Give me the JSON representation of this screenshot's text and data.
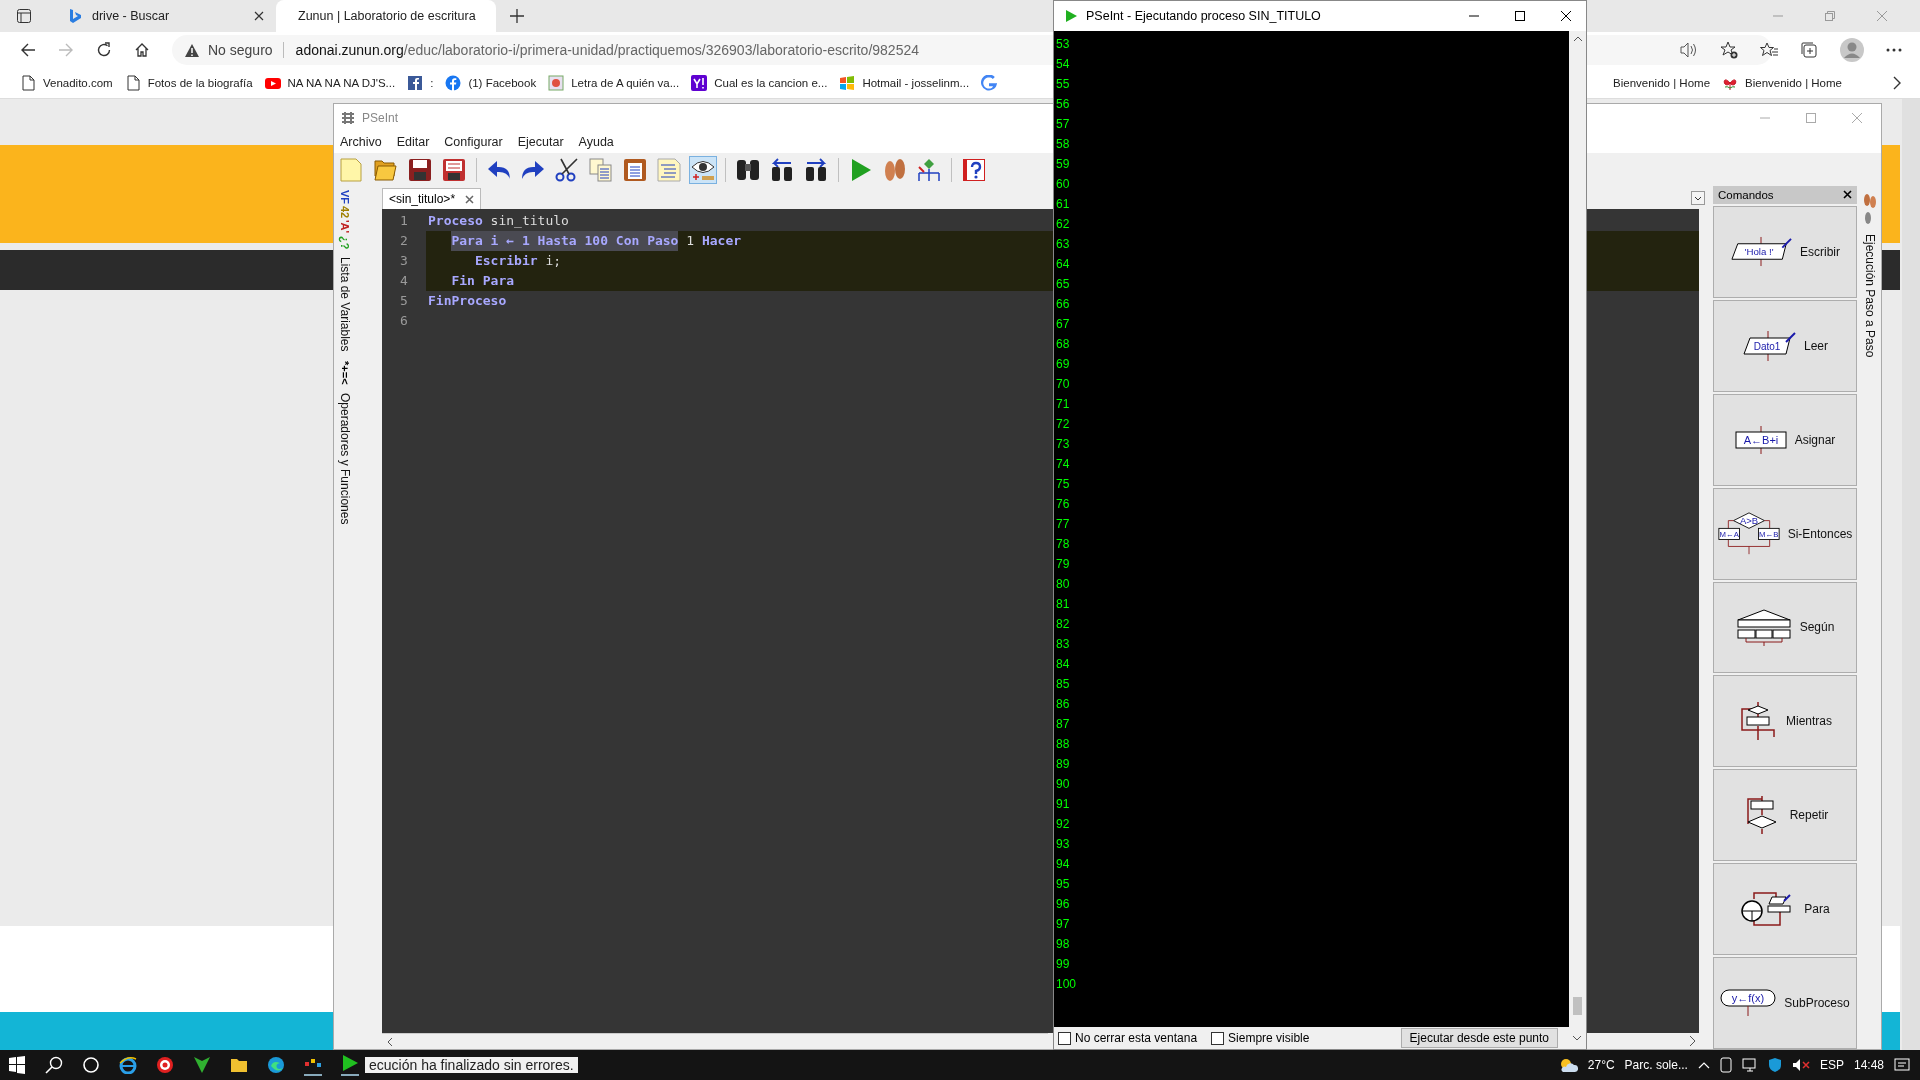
{
  "browser": {
    "tabs": [
      {
        "title": "drive - Buscar",
        "selected": false
      },
      {
        "title": "Zunun | Laboratorio de escritura",
        "selected": true
      }
    ],
    "address": {
      "security": "No seguro",
      "host": "adonai.zunun.org",
      "path": "/educ/laboratorio-i/primera-unidad/practiquemos/326903/laboratorio-escrito/982524"
    },
    "bookmarks": [
      {
        "label": "Venadito.com",
        "kind": "page"
      },
      {
        "label": "Fotos de la biografía",
        "kind": "page"
      },
      {
        "label": "NA NA NA NA DJ'S...",
        "kind": "video"
      },
      {
        "label": ":",
        "kind": "fb-square"
      },
      {
        "label": "(1) Facebook",
        "kind": "fb-round"
      },
      {
        "label": "Letra de A quién va...",
        "kind": "music"
      },
      {
        "label": "Cual es la cancion e...",
        "kind": "yahoo"
      },
      {
        "label": "Hotmail - josselinm...",
        "kind": "windows"
      }
    ],
    "bookmarks_right": [
      {
        "label": "Bienvenido | Home",
        "kind": "plain"
      },
      {
        "label": "Bienvenido | Home",
        "kind": "flower"
      }
    ]
  },
  "pseint": {
    "title": "PSeInt",
    "menu": [
      "Archivo",
      "Editar",
      "Configurar",
      "Ejecutar",
      "Ayuda"
    ],
    "toolbar": [
      [
        {
          "kind": "new",
          "pressed": false
        },
        {
          "kind": "open",
          "pressed": false
        },
        {
          "kind": "save",
          "pressed": false
        },
        {
          "kind": "saveas",
          "pressed": false
        }
      ],
      [
        {
          "kind": "undo",
          "pressed": false
        },
        {
          "kind": "redo",
          "pressed": false
        },
        {
          "kind": "cut",
          "pressed": false
        },
        {
          "kind": "copy",
          "pressed": false
        },
        {
          "kind": "paste",
          "pressed": false
        },
        {
          "kind": "indent",
          "pressed": false
        },
        {
          "kind": "eye",
          "pressed": true
        }
      ],
      [
        {
          "kind": "find",
          "pressed": false
        },
        {
          "kind": "findprev",
          "pressed": false
        },
        {
          "kind": "findnext",
          "pressed": false
        }
      ],
      [
        {
          "kind": "run",
          "pressed": false
        },
        {
          "kind": "step",
          "pressed": false
        },
        {
          "kind": "flow",
          "pressed": false
        }
      ],
      [
        {
          "kind": "help",
          "pressed": false
        }
      ]
    ],
    "side_tabs": [
      {
        "glyphs": [
          {
            "text": "VF",
            "color": "#2040c0"
          },
          {
            "text": "42",
            "color": "#a08000"
          },
          {
            "text": "'A'",
            "color": "#c02020"
          },
          {
            "text": "¿?",
            "color": "#20a020"
          }
        ],
        "label": "Lista de Variables"
      },
      {
        "glyphs": [
          {
            "text": "*+=<",
            "color": "#000000"
          }
        ],
        "label": "Operadores y Funciones"
      }
    ],
    "file_tab": {
      "label": "<sin_titulo>*",
      "selected": true
    },
    "code": [
      {
        "number": "1",
        "highlighted": false,
        "tokens": [
          {
            "text": "Proceso",
            "kind": "keyword"
          },
          {
            "text": "sin_titulo",
            "kind": "ident"
          }
        ],
        "children": [
          {
            "number": "2",
            "highlighted": true,
            "selection": "Para i ← 1 Hasta 100 Con Paso",
            "tokens": [
              {
                "text": "1",
                "kind": "number"
              },
              {
                "text": "Hacer",
                "kind": "keyword"
              }
            ],
            "children": [
              {
                "number": "3",
                "highlighted": true,
                "tokens": [
                  {
                    "text": "Escribir",
                    "kind": "keyword"
                  },
                  {
                    "text": "i;",
                    "kind": "ident"
                  }
                ]
              }
            ]
          },
          {
            "number": "4",
            "highlighted": true,
            "tokens": [
              {
                "text": "Fin Para",
                "kind": "keyword"
              }
            ]
          }
        ]
      },
      {
        "number": "5",
        "highlighted": false,
        "tokens": [
          {
            "text": "FinProceso",
            "kind": "keyword"
          }
        ]
      },
      {
        "number": "6",
        "highlighted": false
      }
    ],
    "commands_title": "Comandos",
    "commands": [
      {
        "label": "Escribir",
        "kind": "escribir",
        "texts": [
          "'Hola !'"
        ]
      },
      {
        "label": "Leer",
        "kind": "leer",
        "texts": [
          "Dato1"
        ]
      },
      {
        "label": "Asignar",
        "kind": "asignar",
        "texts": [
          "A←B+i"
        ]
      },
      {
        "label": "Si-Entonces",
        "kind": "si",
        "texts": [
          "A>B",
          "M←A",
          "M←B"
        ]
      },
      {
        "label": "Según",
        "kind": "segun"
      },
      {
        "label": "Mientras",
        "kind": "mientras"
      },
      {
        "label": "Repetir",
        "kind": "repetir"
      },
      {
        "label": "Para",
        "kind": "para"
      },
      {
        "label": "SubProceso",
        "kind": "subproceso",
        "texts": [
          "y←f(x)"
        ]
      }
    ],
    "right_tab": "Ejecución Paso a Paso",
    "status": "ecución ha finalizado sin errores."
  },
  "console": {
    "title": "PSeInt - Ejecutando proceso SIN_TITULO",
    "lines": [
      "53",
      "54",
      "55",
      "56",
      "57",
      "58",
      "59",
      "60",
      "61",
      "62",
      "63",
      "64",
      "65",
      "66",
      "67",
      "68",
      "69",
      "70",
      "71",
      "72",
      "73",
      "74",
      "75",
      "76",
      "77",
      "78",
      "79",
      "80",
      "81",
      "82",
      "83",
      "84",
      "85",
      "86",
      "87",
      "88",
      "89",
      "90",
      "91",
      "92",
      "93",
      "94",
      "95",
      "96",
      "97",
      "98",
      "99",
      "100"
    ],
    "options": [
      {
        "label": "No cerrar esta ventana",
        "checked": false
      },
      {
        "label": "Siempre visible",
        "checked": false
      }
    ],
    "button": "Ejecutar desde este punto"
  },
  "taskbar": {
    "temperature": "27°C",
    "weather": "Parc. sole...",
    "language": "ESP",
    "time": "14:48"
  }
}
